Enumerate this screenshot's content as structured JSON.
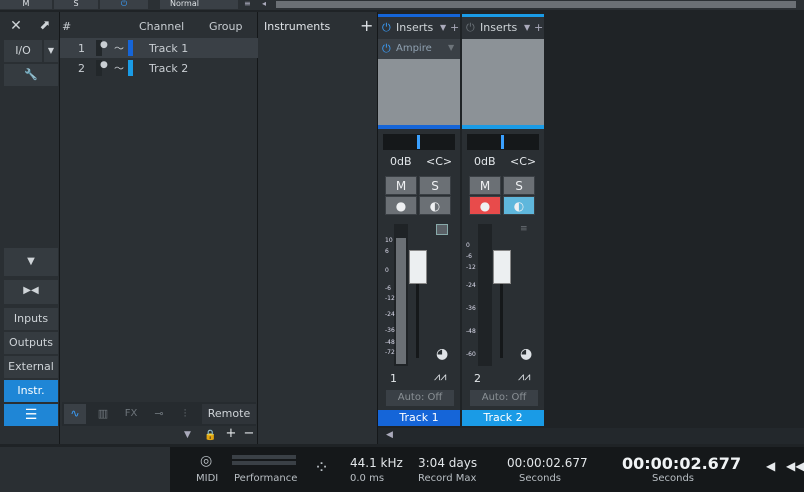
{
  "top_strip": {
    "mute_label": "M",
    "solo_label": "S",
    "mode_label": "Normal"
  },
  "left_panel": {
    "io_label": "I/O",
    "nav": [
      "Inputs",
      "Outputs",
      "External",
      "Instr."
    ]
  },
  "channel_list": {
    "headers": {
      "num": "#",
      "channel": "Channel",
      "group": "Group"
    },
    "rows": [
      {
        "num": "1",
        "name": "Track 1",
        "color": "#1565d8"
      },
      {
        "num": "2",
        "name": "Track 2",
        "color": "#1a9be6"
      }
    ],
    "bottom_fx": "FX",
    "remote": "Remote"
  },
  "instruments": {
    "title": "Instruments",
    "add": "+"
  },
  "mixer": {
    "inserts_label": "Inserts",
    "plugin": "Ampire",
    "strips": [
      {
        "num": "1",
        "name": "Track 1",
        "volume": "0dB",
        "pan": "<C>",
        "auto": "Auto: Off",
        "color": "#1565d8",
        "record_armed": false,
        "monitor_on": false
      },
      {
        "num": "2",
        "name": "Track 2",
        "volume": "0dB",
        "pan": "<C>",
        "auto": "Auto: Off",
        "color": "#1a9be6",
        "record_armed": true,
        "monitor_on": true
      }
    ],
    "mute": "M",
    "solo": "S",
    "scale1": [
      "10",
      "6",
      "0",
      "-6",
      "-12",
      "-24",
      "-36",
      "-48",
      "-72"
    ],
    "scale2": [
      "0",
      "-6",
      "-12",
      "-24",
      "-36",
      "-48",
      "-60"
    ]
  },
  "transport": {
    "midi": "MIDI",
    "performance": "Performance",
    "sample_rate": "44.1 kHz",
    "latency": "0.0 ms",
    "record_max": "3:04 days",
    "record_max_label": "Record Max",
    "time_small": "00:00:02.677",
    "seconds_label": "Seconds",
    "time_big": "00:00:02.677",
    "seconds_label2": "Seconds"
  },
  "colors": {
    "track1": "#1565d8",
    "track2": "#1a9be6",
    "record": "#e84b4b",
    "monitor": "#5fb7dc",
    "panel": "#2a2f33"
  }
}
